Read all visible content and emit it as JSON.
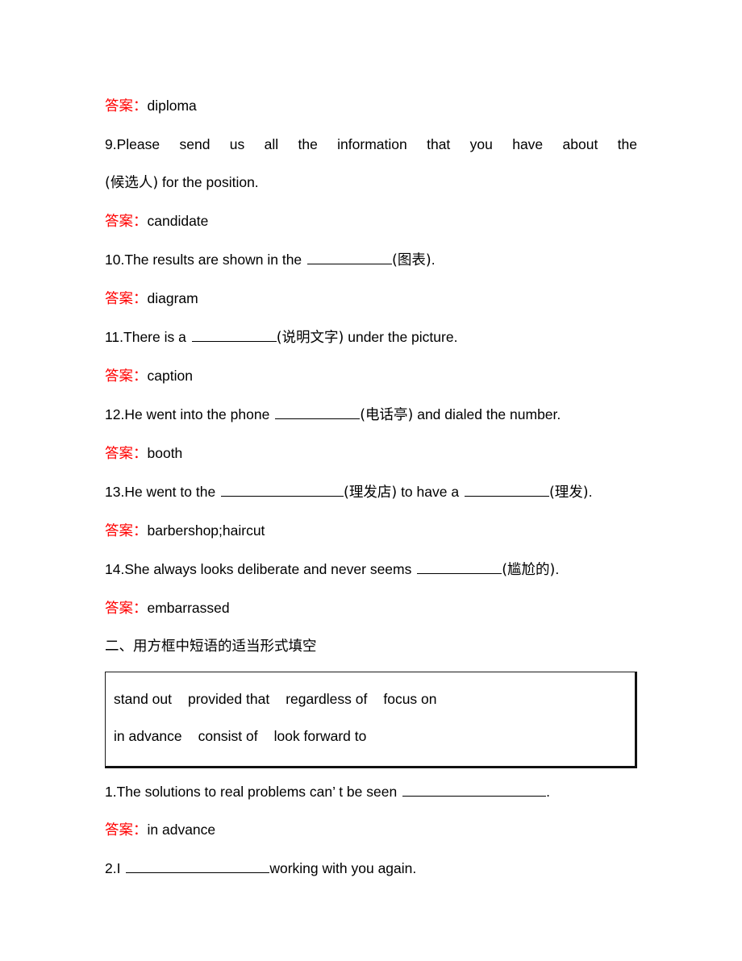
{
  "document": {
    "type": "english-exercise-worksheet",
    "answer_label": "答案",
    "answer_separator": "：",
    "accent_color": "#ff0000",
    "text_color": "#000000",
    "background_color": "#ffffff"
  },
  "vocabulary_section": {
    "items": [
      {
        "kind": "answer",
        "label": "答案",
        "separator": "：",
        "value": "diploma"
      },
      {
        "kind": "question",
        "number": "9.",
        "line1": "Please send us all the information that you have about the",
        "line2_prefix": "",
        "hint": "(候选人)",
        "line2_suffix": " for the position."
      },
      {
        "kind": "answer",
        "label": "答案",
        "separator": "：",
        "value": "candidate"
      },
      {
        "kind": "question",
        "number": "10.",
        "prefix": "The results are shown in the ",
        "hint": "(图表)",
        "suffix": "."
      },
      {
        "kind": "answer",
        "label": "答案",
        "separator": "：",
        "value": "diagram"
      },
      {
        "kind": "question",
        "number": "11.",
        "prefix": "There is a ",
        "hint": "(说明文字)",
        "suffix": " under the picture."
      },
      {
        "kind": "answer",
        "label": "答案",
        "separator": "：",
        "value": "caption"
      },
      {
        "kind": "question",
        "number": "12.",
        "prefix": "He went into the phone ",
        "hint": "(电话亭)",
        "suffix": " and dialed the number."
      },
      {
        "kind": "answer",
        "label": "答案",
        "separator": "：",
        "value": "booth"
      },
      {
        "kind": "question",
        "number": "13.",
        "prefix": "He went to the ",
        "hint": "(理发店)",
        "middle": " to have a ",
        "hint2": "(理发)",
        "suffix": "."
      },
      {
        "kind": "answer",
        "label": "答案",
        "separator": "：",
        "value": "barbershop;haircut"
      },
      {
        "kind": "question",
        "number": "14.",
        "prefix": "She always looks deliberate and never seems ",
        "hint": "(尴尬的)",
        "suffix": "."
      },
      {
        "kind": "answer",
        "label": "答案",
        "separator": "：",
        "value": "embarrassed"
      }
    ]
  },
  "phrase_section": {
    "heading": "二、用方框中短语的适当形式填空",
    "word_box": {
      "row1": [
        "stand out",
        "provided that",
        "regardless of",
        "focus on"
      ],
      "row2": [
        "in advance",
        "consist of",
        "look forward to"
      ]
    },
    "items": [
      {
        "kind": "question",
        "number": "1.",
        "prefix": "The solutions to real problems can’ t be seen ",
        "suffix": "."
      },
      {
        "kind": "answer",
        "label": "答案",
        "separator": "：",
        "value": "in advance"
      },
      {
        "kind": "question",
        "number": "2.",
        "prefix": "I ",
        "suffix": "working with you again."
      }
    ]
  }
}
